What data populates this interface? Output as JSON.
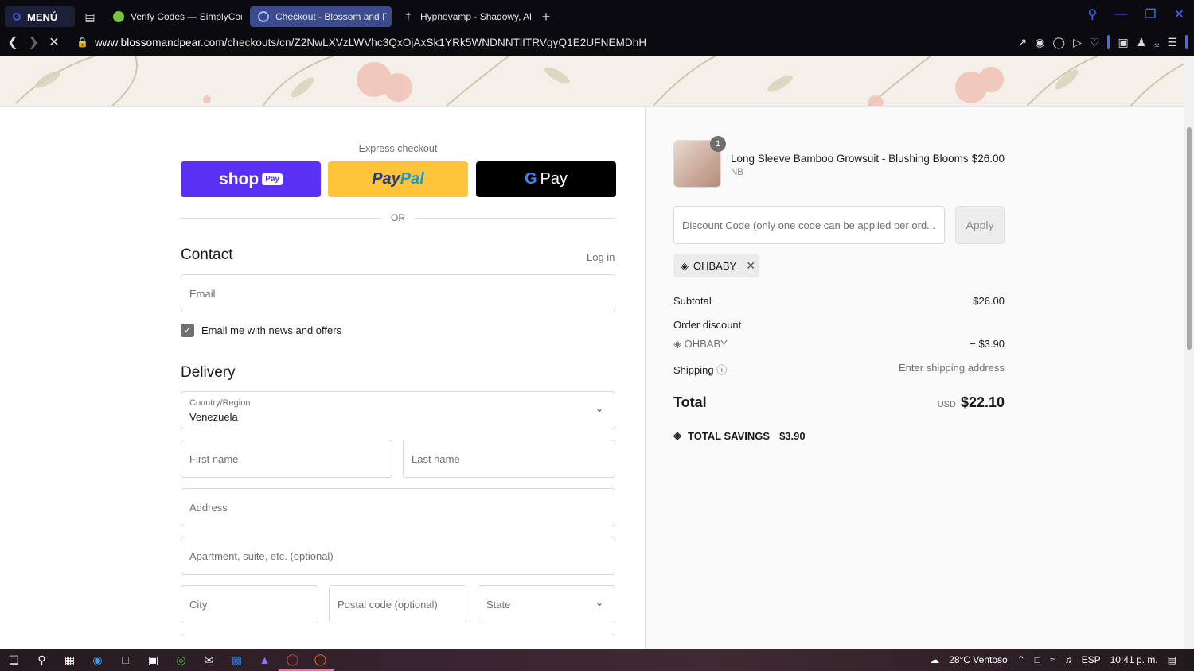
{
  "browser": {
    "menu_label": "MENÚ",
    "tabs": [
      {
        "label": "Verify Codes — SimplyCod",
        "active": false,
        "favicon_color": "#7bc142"
      },
      {
        "label": "Checkout - Blossom and P",
        "active": true,
        "favicon_color": "#3a6cff"
      },
      {
        "label": "Hypnovamp - Shadowy, Al",
        "active": false,
        "favicon_color": "#cccccc"
      }
    ],
    "new_tab": "+",
    "url_domain": "www.blossomandpear.com",
    "url_path": "/checkouts/cn/Z2NwLXVzLWVhc3QxOjAxSk1YRk5WNDNNTlITRVgyQ1E2UFNEMDhH",
    "accent": "#3a6cff"
  },
  "checkout": {
    "express_label": "Express checkout",
    "shop_label": "shop",
    "shop_badge": "Pay",
    "paypal_pay": "Pay",
    "paypal_pal": "Pal",
    "gpay_g": "G",
    "gpay_label": "Pay",
    "or_label": "OR",
    "contact_heading": "Contact",
    "login_link": "Log in",
    "email_placeholder": "Email",
    "news_label": "Email me with news and offers",
    "delivery_heading": "Delivery",
    "country_label": "Country/Region",
    "country_value": "Venezuela",
    "first_name": "First name",
    "last_name": "Last name",
    "address": "Address",
    "apartment": "Apartment, suite, etc. (optional)",
    "city": "City",
    "postal": "Postal code (optional)",
    "state": "State",
    "brand_color": "#5a31f4",
    "paypal_color": "#ffc439"
  },
  "summary": {
    "qty": "1",
    "product_name": "Long Sleeve Bamboo Growsuit - Blushing Blooms",
    "product_variant": "NB",
    "product_price": "$26.00",
    "discount_placeholder": "Discount Code (only one code can be applied per ord...",
    "apply_label": "Apply",
    "code_chip": "OHBABY",
    "subtotal_label": "Subtotal",
    "subtotal_value": "$26.00",
    "order_discount_label": "Order discount",
    "discount_code": "OHBABY",
    "discount_value": "− $3.90",
    "shipping_label": "Shipping",
    "shipping_value": "Enter shipping address",
    "total_label": "Total",
    "currency": "USD",
    "total_value": "$22.10",
    "savings_label": "TOTAL SAVINGS",
    "savings_value": "$3.90"
  },
  "taskbar": {
    "weather": "28°C  Ventoso",
    "lang": "ESP",
    "time": "10:41 p. m."
  }
}
